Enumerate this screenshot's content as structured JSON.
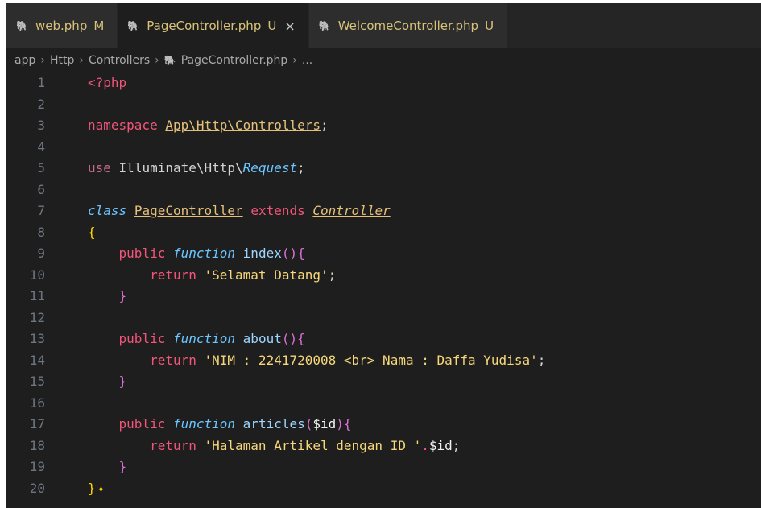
{
  "tabs": [
    {
      "label": "web.php",
      "status": "M",
      "active": false
    },
    {
      "label": "PageController.php",
      "status": "U",
      "active": true,
      "close": "×"
    },
    {
      "label": "WelcomeController.php",
      "status": "U",
      "active": false
    }
  ],
  "breadcrumb": {
    "items": [
      "app",
      "Http",
      "Controllers",
      "PageController.php",
      "..."
    ]
  },
  "editor": {
    "line_numbers": [
      "1",
      "2",
      "3",
      "4",
      "5",
      "6",
      "7",
      "8",
      "9",
      "10",
      "11",
      "12",
      "13",
      "14",
      "15",
      "16",
      "17",
      "18",
      "19",
      "20"
    ],
    "tokens": {
      "l1_open": "<?php",
      "l3_kw": "namespace",
      "l3_ns": "App\\Http\\Controllers",
      "l3_semi": ";",
      "l5_use": "use",
      "l5_path": "Illuminate\\Http\\",
      "l5_cls": "Request",
      "l5_semi": ";",
      "l7_class": "class",
      "l7_name": "PageController",
      "l7_extends": "extends",
      "l7_parent": "Controller",
      "l8_brace": "{",
      "public": "public",
      "function": "function",
      "l9_fn": "index",
      "l9_parens": "()",
      "l9_open": "{",
      "return": "return",
      "l10_str": "'Selamat Datang'",
      "l10_semi": ";",
      "close_brace": "}",
      "l13_fn": "about",
      "l13_parens": "()",
      "l13_open": "{",
      "l14_str": "'NIM : 2241720008 <br> Nama : Daffa Yudisa'",
      "l14_semi": ";",
      "l17_fn": "articles",
      "l17_paren_open": "(",
      "l17_var": "$id",
      "l17_paren_close": ")",
      "l17_open": "{",
      "l18_str": "'Halaman Artikel dengan ID '",
      "l18_dot": ".",
      "l18_var": "$id",
      "l18_semi": ";",
      "l20_brace": "}",
      "l20_sparkle": "✦"
    }
  },
  "colors": {
    "background": "#1e1e1e",
    "tab_status": "#d8c27a",
    "keyword": "#f2557a",
    "italic_keyword": "#6cc6ff",
    "string": "#f7d77a"
  }
}
